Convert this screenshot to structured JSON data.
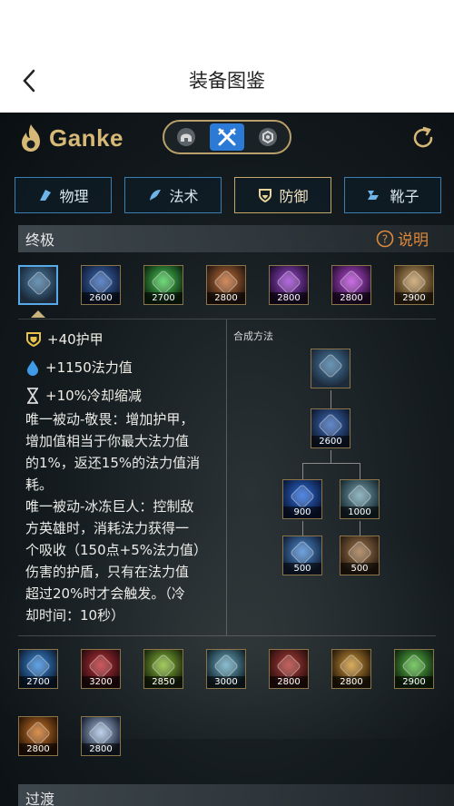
{
  "header": {
    "title": "装备图鉴",
    "back_icon": "chevron-left-icon"
  },
  "logo": {
    "text": "Ganke",
    "icon": "flame-icon",
    "color": "#d6b877"
  },
  "mode_switch": {
    "options": [
      {
        "icon": "helmet-icon",
        "active": false
      },
      {
        "icon": "crossed-swords-icon",
        "active": true
      },
      {
        "icon": "hexagon-icon",
        "active": false
      }
    ],
    "active_color": "#2b7bd6"
  },
  "refresh_icon": "refresh-icon",
  "categories": [
    {
      "label": "物理",
      "icon": "physical-icon",
      "active": false
    },
    {
      "label": "法术",
      "icon": "magic-icon",
      "active": false
    },
    {
      "label": "防御",
      "icon": "shield-icon",
      "active": true
    },
    {
      "label": "靴子",
      "icon": "boots-icon",
      "active": false
    }
  ],
  "section_ultimate": {
    "label": "终极",
    "explain_label": "说明"
  },
  "ultimate_items": [
    {
      "cost": "",
      "colors": [
        "#4a7fa8",
        "#1c2a3a"
      ],
      "selected": true
    },
    {
      "cost": "2600",
      "colors": [
        "#3f6fbf",
        "#101c34"
      ]
    },
    {
      "cost": "2700",
      "colors": [
        "#4fd25a",
        "#0d2a12"
      ]
    },
    {
      "cost": "2800",
      "colors": [
        "#c9733a",
        "#2a1a12"
      ]
    },
    {
      "cost": "2800",
      "colors": [
        "#a44ad8",
        "#1e0f30"
      ]
    },
    {
      "cost": "2800",
      "colors": [
        "#c04fe0",
        "#2a0f36"
      ]
    },
    {
      "cost": "2900",
      "colors": [
        "#c9a46a",
        "#3a2a16"
      ]
    }
  ],
  "stats": [
    {
      "icon": "shield-stat-icon",
      "text": "+40护甲"
    },
    {
      "icon": "mana-drop-icon",
      "text": "+1150法力值"
    },
    {
      "icon": "hourglass-icon",
      "text": "+10%冷却缩减"
    }
  ],
  "description": "唯一被动-敬畏：增加护甲，\n增加值相当于你最大法力值\n的1%，返还15%的法力值消\n耗。\n唯一被动-冰冻巨人：控制敌\n方英雄时，消耗法力获得一\n个吸收（150点+5%法力值）\n伤害的护盾，只有在法力值\n超过20%时才会触发。（冷\n却时间：10秒）",
  "recipe": {
    "label": "合成方法",
    "top": {
      "cost": "",
      "colors": [
        "#4a7fa8",
        "#1c2a3a"
      ]
    },
    "mid": {
      "cost": "2600",
      "colors": [
        "#3f6fbf",
        "#101c34"
      ]
    },
    "left": {
      "cost": "900",
      "colors": [
        "#2d6fe0",
        "#0c1a3c"
      ]
    },
    "right": {
      "cost": "1000",
      "colors": [
        "#7aa8b5",
        "#1a2c34"
      ]
    },
    "left_child": {
      "cost": "500",
      "colors": [
        "#4f8fd8",
        "#14243c"
      ]
    },
    "right_child": {
      "cost": "500",
      "colors": [
        "#a67c52",
        "#2e2014"
      ]
    }
  },
  "more_items": [
    {
      "cost": "2700",
      "colors": [
        "#3f8fe0",
        "#0e2038"
      ]
    },
    {
      "cost": "3200",
      "colors": [
        "#c2343a",
        "#2c0c10"
      ]
    },
    {
      "cost": "2850",
      "colors": [
        "#8fbf3a",
        "#1c2a0e"
      ]
    },
    {
      "cost": "3000",
      "colors": [
        "#6fb0c8",
        "#14262e"
      ]
    },
    {
      "cost": "2800",
      "colors": [
        "#b8403a",
        "#2c1010"
      ]
    },
    {
      "cost": "2800",
      "colors": [
        "#d29a3a",
        "#2e1e0c"
      ]
    },
    {
      "cost": "2900",
      "colors": [
        "#5fc04a",
        "#102a10"
      ]
    },
    {
      "cost": "2800",
      "colors": [
        "#d27a2a",
        "#2e1808"
      ]
    },
    {
      "cost": "2800",
      "colors": [
        "#b0c8e8",
        "#1c2436"
      ]
    }
  ],
  "section_transition": {
    "label": "过渡"
  }
}
